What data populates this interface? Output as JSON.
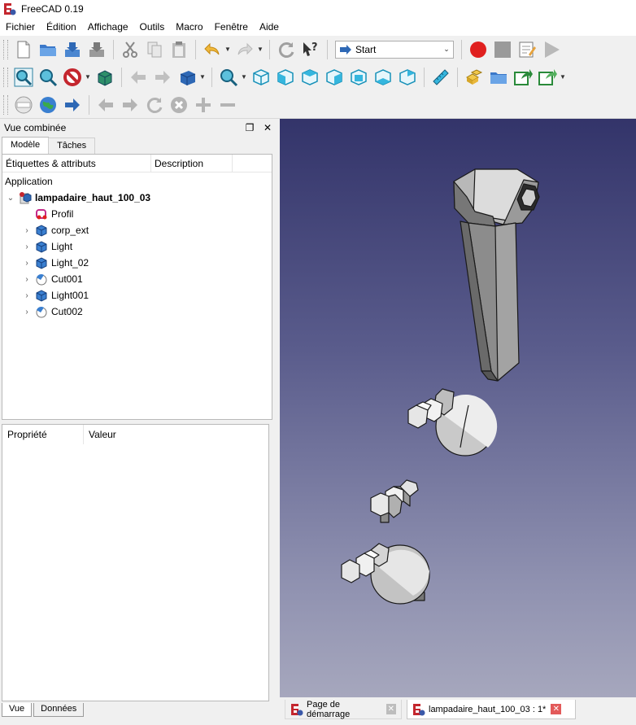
{
  "window": {
    "title": "FreeCAD 0.19"
  },
  "menu": [
    "Fichier",
    "Édition",
    "Affichage",
    "Outils",
    "Macro",
    "Fenêtre",
    "Aide"
  ],
  "toolbar": {
    "workbench": "Start",
    "icons_row1": [
      "new-icon",
      "open-icon",
      "save-icon",
      "save-as-icon",
      "cut-icon",
      "copy-icon",
      "paste-icon",
      "undo-icon",
      "redo-icon",
      "refresh-icon",
      "whats-this-icon"
    ],
    "icons_macro": [
      "record-macro-icon",
      "stop-macro-icon",
      "edit-macro-icon",
      "run-macro-icon"
    ],
    "icons_row2": [
      "fit-all-icon",
      "fit-selection-icon",
      "draw-style-icon",
      "bounding-box-icon",
      "back-view-icon",
      "forward-view-icon",
      "std-views-icon",
      "zoom-icon",
      "isometric-icon",
      "front-icon",
      "top-icon",
      "right-icon",
      "rear-icon",
      "bottom-icon",
      "left-icon",
      "measure-icon",
      "part-icon",
      "group-icon",
      "link-icon",
      "link-actions-icon"
    ],
    "icons_row3": [
      "web-icon",
      "globe-icon",
      "go-forward-icon",
      "web-back-icon",
      "web-next-icon",
      "web-refresh-icon",
      "web-stop-icon",
      "zoom-in-icon",
      "zoom-out-icon"
    ]
  },
  "combo_view": {
    "title": "Vue combinée",
    "tabs": [
      "Modèle",
      "Tâches"
    ],
    "tree_columns": [
      "Étiquettes & attributs",
      "Description"
    ],
    "application_label": "Application",
    "document": "lampadaire_haut_100_03",
    "items": [
      {
        "label": "Profil",
        "icon": "sketch-icon",
        "expandable": false
      },
      {
        "label": "corp_ext",
        "icon": "body-icon",
        "expandable": true
      },
      {
        "label": "Light",
        "icon": "body-icon",
        "expandable": true
      },
      {
        "label": "Light_02",
        "icon": "body-icon",
        "expandable": true
      },
      {
        "label": "Cut001",
        "icon": "cut-bool-icon",
        "expandable": true
      },
      {
        "label": "Light001",
        "icon": "body-icon",
        "expandable": true
      },
      {
        "label": "Cut002",
        "icon": "cut-bool-icon",
        "expandable": true
      }
    ],
    "property_columns": [
      "Propriété",
      "Valeur"
    ],
    "bottom_tabs": [
      "Vue",
      "Données"
    ]
  },
  "doc_tabs": [
    {
      "label": "Page de démarrage"
    },
    {
      "label": "lampadaire_haut_100_03 : 1*"
    }
  ],
  "colors": {
    "viewport_top": "#33346a",
    "viewport_bottom": "#a6a7bd",
    "record": "#e0201f",
    "close_badge": "#e35a5a"
  }
}
